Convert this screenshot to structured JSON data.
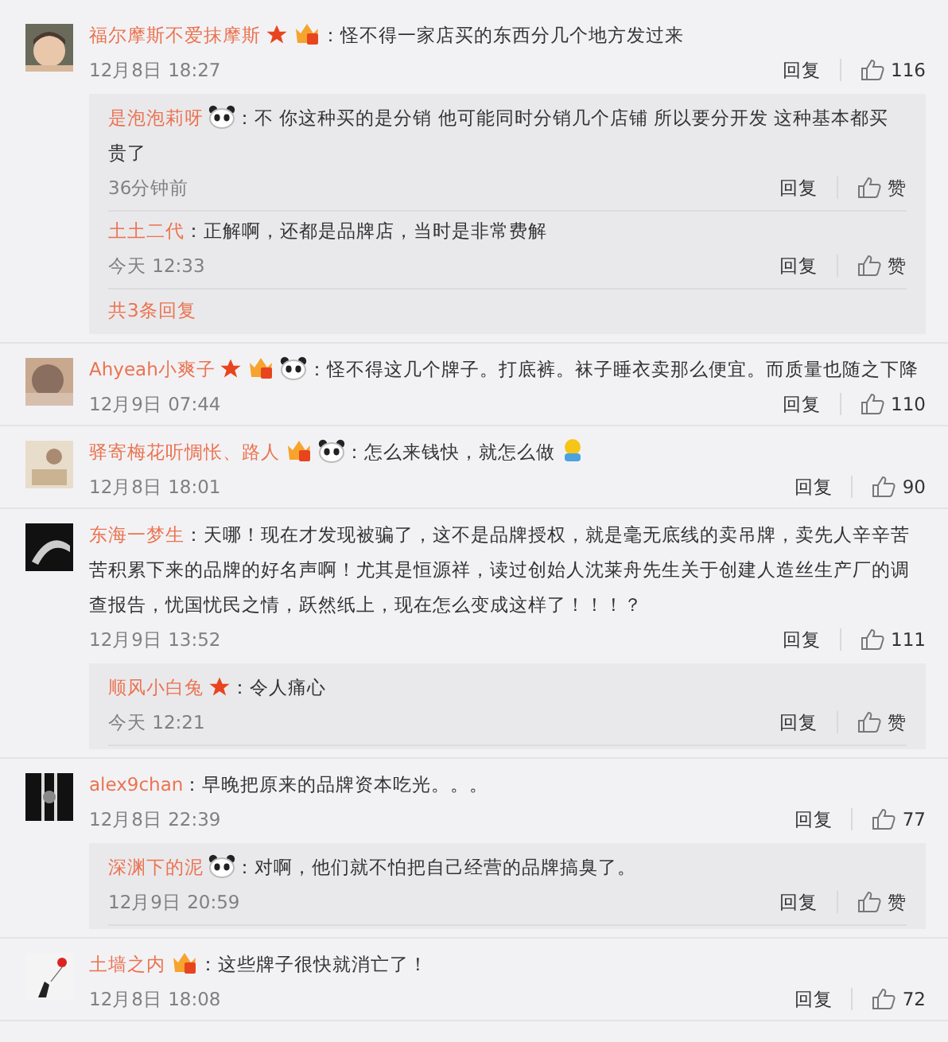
{
  "comments": [
    {
      "user": "福尔摩斯不爱抹摩斯",
      "star": true,
      "vip": true,
      "text": "：怪不得一家店买的东西分几个地方发过来",
      "time": "12月8日 18:27",
      "reply_label": "回复",
      "likes": "116",
      "replies": [
        {
          "user": "是泡泡莉呀",
          "panda": true,
          "text": "：不 你这种买的是分销 他可能同时分销几个店铺 所以要分开发 这种基本都买贵了",
          "time": "36分钟前",
          "reply_label": "回复",
          "likes": "赞"
        },
        {
          "user": "土土二代",
          "text": "：正解啊，还都是品牌店，当时是非常费解",
          "time": "今天 12:33",
          "reply_label": "回复",
          "likes": "赞"
        }
      ],
      "more": "共3条回复"
    },
    {
      "user": "Ahyeah小爽子",
      "star": true,
      "vip": true,
      "panda": true,
      "text": "：怪不得这几个牌子。打底裤。袜子睡衣卖那么便宜。而质量也随之下降",
      "time": "12月9日 07:44",
      "reply_label": "回复",
      "likes": "110"
    },
    {
      "user": "驿寄梅花听惆怅、路人",
      "vip": true,
      "panda": true,
      "text": "：怎么来钱快，就怎么做",
      "end_emoji": true,
      "time": "12月8日 18:01",
      "reply_label": "回复",
      "likes": "90"
    },
    {
      "user": "东海一梦生",
      "text": "：天哪！现在才发现被骗了，这不是品牌授权，就是毫无底线的卖吊牌，卖先人辛辛苦苦积累下来的品牌的好名声啊！尤其是恒源祥，读过创始人沈莱舟先生关于创建人造丝生产厂的调查报告，忧国忧民之情，跃然纸上，现在怎么变成这样了！！！？",
      "time": "12月9日 13:52",
      "reply_label": "回复",
      "likes": "111",
      "replies": [
        {
          "user": "顺风小白兔",
          "star": true,
          "text": "：令人痛心",
          "time": "今天 12:21",
          "reply_label": "回复",
          "likes": "赞"
        }
      ]
    },
    {
      "user": "alex9chan",
      "text": "：早晚把原来的品牌资本吃光。。。",
      "time": "12月8日 22:39",
      "reply_label": "回复",
      "likes": "77",
      "replies": [
        {
          "user": "深渊下的泥",
          "panda": true,
          "text": "：对啊，他们就不怕把自己经营的品牌搞臭了。",
          "time": "12月9日 20:59",
          "reply_label": "回复",
          "likes": "赞"
        }
      ]
    },
    {
      "user": "土墙之内",
      "vip": true,
      "text": "：这些牌子很快就消亡了！",
      "time": "12月8日 18:08",
      "reply_label": "回复",
      "likes": "72"
    }
  ]
}
